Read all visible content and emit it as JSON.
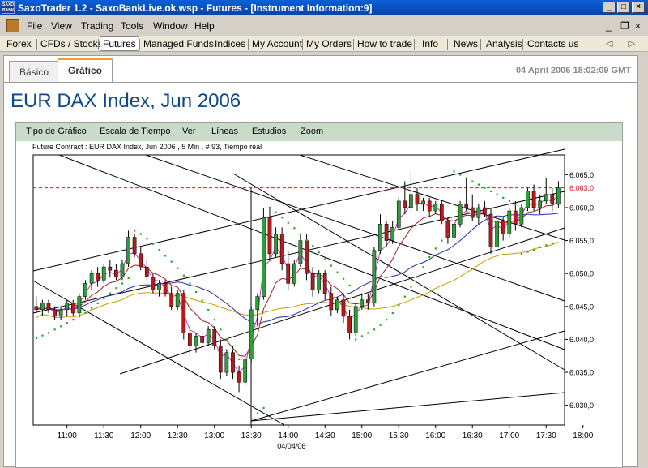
{
  "window": {
    "title": "SaxoTrader 1.2 - SaxoBankLive.ok.wsp - Futures - [Instrument Information:9]",
    "logo_text": "SAXO BANK",
    "controls": [
      "_",
      "□",
      "×"
    ]
  },
  "menu": {
    "items": [
      "File",
      "View",
      "Trading",
      "Tools",
      "Window",
      "Help"
    ],
    "mdi_controls": [
      "_",
      "❐",
      "×"
    ]
  },
  "nav": {
    "items": [
      "Forex",
      "CFDs / Stocks",
      "Futures",
      "Managed Funds",
      "Indices",
      "My Account",
      "My Orders",
      "How to trade",
      "Info",
      "News",
      "Analysis",
      "Contacts us"
    ],
    "active": "Futures",
    "arrows": "◁ ▷"
  },
  "tabs": {
    "items": [
      "Básico",
      "Gráfico"
    ],
    "active": "Gráfico"
  },
  "timestamp": "04 April 2006 18:02:09 GMT",
  "instrument_title": "EUR DAX Index, Jun 2006",
  "chart_toolbar": [
    "Tipo de Gráfico",
    "Escala de Tiempo",
    "Ver",
    "Líneas",
    "Estudios",
    "Zoom"
  ],
  "contract_info": "Future Contract : EUR DAX Index, Jun 2006 , 5 Min , # 93, Tiempo real",
  "colors": {
    "up_candle": "#2e9e3a",
    "down_candle": "#b81a1a",
    "ma_fast": "#cc33cc",
    "ma_mid": "#a02020",
    "ma_slow": "#2a2ab0",
    "ma_long": "#c8a000",
    "sar": "#22aa22",
    "last_price": "#d02020"
  },
  "chart_data": {
    "type": "candlestick",
    "xlabel": "04/04/06",
    "x_ticks": [
      "11:00",
      "11:30",
      "12:00",
      "12:30",
      "13:00",
      "13:30",
      "14:00",
      "14:30",
      "15:00",
      "15:30",
      "16:00",
      "16:30",
      "17:00",
      "17:30",
      "18:00"
    ],
    "y_ticks": [
      "6.065,0",
      "6.060,0",
      "6.055,0",
      "6.050,0",
      "6.045,0",
      "6.040,0",
      "6.035,0",
      "6.030,0"
    ],
    "ylim": [
      6027,
      6068
    ],
    "last_price": 6063.0,
    "last_price_label": "6.063,0",
    "interval_minutes": 5,
    "start_time": "10:35",
    "candles": [
      {
        "o": 6045.0,
        "h": 6046.5,
        "l": 6044.0,
        "c": 6044.5
      },
      {
        "o": 6044.5,
        "h": 6046.0,
        "l": 6043.5,
        "c": 6045.5
      },
      {
        "o": 6045.5,
        "h": 6046.0,
        "l": 6044.0,
        "c": 6044.5
      },
      {
        "o": 6044.5,
        "h": 6045.0,
        "l": 6043.0,
        "c": 6043.5
      },
      {
        "o": 6043.5,
        "h": 6045.0,
        "l": 6043.0,
        "c": 6044.5
      },
      {
        "o": 6044.5,
        "h": 6046.0,
        "l": 6043.5,
        "c": 6045.5
      },
      {
        "o": 6045.5,
        "h": 6046.0,
        "l": 6043.5,
        "c": 6044.0
      },
      {
        "o": 6044.0,
        "h": 6047.0,
        "l": 6043.5,
        "c": 6046.5
      },
      {
        "o": 6046.5,
        "h": 6049.0,
        "l": 6046.0,
        "c": 6048.5
      },
      {
        "o": 6048.5,
        "h": 6050.5,
        "l": 6047.5,
        "c": 6050.0
      },
      {
        "o": 6050.0,
        "h": 6051.0,
        "l": 6048.0,
        "c": 6049.0
      },
      {
        "o": 6049.0,
        "h": 6051.5,
        "l": 6048.5,
        "c": 6051.0
      },
      {
        "o": 6051.0,
        "h": 6052.0,
        "l": 6049.5,
        "c": 6050.5
      },
      {
        "o": 6050.5,
        "h": 6051.5,
        "l": 6049.0,
        "c": 6049.5
      },
      {
        "o": 6049.5,
        "h": 6052.0,
        "l": 6049.0,
        "c": 6051.5
      },
      {
        "o": 6051.5,
        "h": 6056.5,
        "l": 6051.0,
        "c": 6055.5
      },
      {
        "o": 6055.5,
        "h": 6056.0,
        "l": 6052.5,
        "c": 6053.0
      },
      {
        "o": 6053.0,
        "h": 6054.0,
        "l": 6050.5,
        "c": 6051.0
      },
      {
        "o": 6051.0,
        "h": 6052.0,
        "l": 6049.0,
        "c": 6049.5
      },
      {
        "o": 6049.5,
        "h": 6050.0,
        "l": 6047.0,
        "c": 6047.5
      },
      {
        "o": 6047.5,
        "h": 6049.0,
        "l": 6046.5,
        "c": 6048.5
      },
      {
        "o": 6048.5,
        "h": 6049.0,
        "l": 6046.5,
        "c": 6047.0
      },
      {
        "o": 6047.0,
        "h": 6048.0,
        "l": 6044.5,
        "c": 6045.0
      },
      {
        "o": 6045.0,
        "h": 6047.5,
        "l": 6044.5,
        "c": 6047.0
      },
      {
        "o": 6047.0,
        "h": 6047.5,
        "l": 6040.0,
        "c": 6041.0
      },
      {
        "o": 6041.0,
        "h": 6042.0,
        "l": 6037.5,
        "c": 6039.0
      },
      {
        "o": 6039.0,
        "h": 6041.0,
        "l": 6038.0,
        "c": 6040.5
      },
      {
        "o": 6040.5,
        "h": 6042.0,
        "l": 6038.5,
        "c": 6039.5
      },
      {
        "o": 6039.5,
        "h": 6042.0,
        "l": 6039.0,
        "c": 6041.5
      },
      {
        "o": 6041.5,
        "h": 6042.0,
        "l": 6038.5,
        "c": 6039.0
      },
      {
        "o": 6039.0,
        "h": 6040.0,
        "l": 6034.0,
        "c": 6035.0
      },
      {
        "o": 6035.0,
        "h": 6038.5,
        "l": 6034.5,
        "c": 6038.0
      },
      {
        "o": 6038.0,
        "h": 6039.0,
        "l": 6034.0,
        "c": 6035.0
      },
      {
        "o": 6035.0,
        "h": 6036.0,
        "l": 6032.0,
        "c": 6033.5
      },
      {
        "o": 6033.5,
        "h": 6037.5,
        "l": 6033.0,
        "c": 6037.0
      },
      {
        "o": 6037.0,
        "h": 6045.0,
        "l": 6036.5,
        "c": 6044.5
      },
      {
        "o": 6044.5,
        "h": 6047.0,
        "l": 6042.0,
        "c": 6046.5
      },
      {
        "o": 6046.5,
        "h": 6060.0,
        "l": 6046.0,
        "c": 6058.5
      },
      {
        "o": 6058.5,
        "h": 6060.0,
        "l": 6052.0,
        "c": 6053.0
      },
      {
        "o": 6053.0,
        "h": 6057.0,
        "l": 6052.5,
        "c": 6056.0
      },
      {
        "o": 6056.0,
        "h": 6057.0,
        "l": 6050.5,
        "c": 6051.5
      },
      {
        "o": 6051.5,
        "h": 6053.5,
        "l": 6047.5,
        "c": 6048.5
      },
      {
        "o": 6048.5,
        "h": 6052.0,
        "l": 6048.0,
        "c": 6051.5
      },
      {
        "o": 6051.5,
        "h": 6056.0,
        "l": 6051.0,
        "c": 6055.0
      },
      {
        "o": 6055.0,
        "h": 6056.0,
        "l": 6049.0,
        "c": 6050.0
      },
      {
        "o": 6050.0,
        "h": 6051.0,
        "l": 6046.5,
        "c": 6047.5
      },
      {
        "o": 6047.5,
        "h": 6050.5,
        "l": 6047.0,
        "c": 6050.0
      },
      {
        "o": 6050.0,
        "h": 6050.5,
        "l": 6046.0,
        "c": 6047.0
      },
      {
        "o": 6047.0,
        "h": 6048.0,
        "l": 6043.5,
        "c": 6044.5
      },
      {
        "o": 6044.5,
        "h": 6046.5,
        "l": 6044.0,
        "c": 6046.0
      },
      {
        "o": 6046.0,
        "h": 6047.0,
        "l": 6042.5,
        "c": 6043.5
      },
      {
        "o": 6043.5,
        "h": 6044.5,
        "l": 6040.0,
        "c": 6041.0
      },
      {
        "o": 6041.0,
        "h": 6045.5,
        "l": 6040.5,
        "c": 6045.0
      },
      {
        "o": 6045.0,
        "h": 6047.0,
        "l": 6044.5,
        "c": 6046.0
      },
      {
        "o": 6046.0,
        "h": 6047.0,
        "l": 6044.5,
        "c": 6045.5
      },
      {
        "o": 6045.5,
        "h": 6054.0,
        "l": 6045.0,
        "c": 6053.5
      },
      {
        "o": 6053.5,
        "h": 6059.0,
        "l": 6053.0,
        "c": 6057.5
      },
      {
        "o": 6057.5,
        "h": 6058.0,
        "l": 6054.0,
        "c": 6055.0
      },
      {
        "o": 6055.0,
        "h": 6058.0,
        "l": 6054.5,
        "c": 6057.0
      },
      {
        "o": 6057.0,
        "h": 6061.5,
        "l": 6056.5,
        "c": 6061.0
      },
      {
        "o": 6061.0,
        "h": 6064.0,
        "l": 6059.0,
        "c": 6060.0
      },
      {
        "o": 6060.0,
        "h": 6065.5,
        "l": 6059.5,
        "c": 6062.0
      },
      {
        "o": 6062.0,
        "h": 6063.0,
        "l": 6059.5,
        "c": 6060.5
      },
      {
        "o": 6060.5,
        "h": 6061.5,
        "l": 6059.5,
        "c": 6061.0
      },
      {
        "o": 6061.0,
        "h": 6061.5,
        "l": 6058.5,
        "c": 6059.5
      },
      {
        "o": 6059.5,
        "h": 6061.0,
        "l": 6059.0,
        "c": 6060.5
      },
      {
        "o": 6060.5,
        "h": 6061.0,
        "l": 6057.5,
        "c": 6058.0
      },
      {
        "o": 6058.0,
        "h": 6058.5,
        "l": 6054.5,
        "c": 6055.5
      },
      {
        "o": 6055.5,
        "h": 6058.0,
        "l": 6055.0,
        "c": 6057.5
      },
      {
        "o": 6057.5,
        "h": 6061.0,
        "l": 6057.0,
        "c": 6060.5
      },
      {
        "o": 6060.5,
        "h": 6064.5,
        "l": 6059.5,
        "c": 6060.0
      },
      {
        "o": 6060.0,
        "h": 6062.0,
        "l": 6058.0,
        "c": 6058.5
      },
      {
        "o": 6058.5,
        "h": 6060.5,
        "l": 6057.5,
        "c": 6060.0
      },
      {
        "o": 6060.0,
        "h": 6061.0,
        "l": 6058.5,
        "c": 6059.0
      },
      {
        "o": 6059.0,
        "h": 6060.0,
        "l": 6053.0,
        "c": 6054.0
      },
      {
        "o": 6054.0,
        "h": 6058.5,
        "l": 6053.5,
        "c": 6058.0
      },
      {
        "o": 6058.0,
        "h": 6058.5,
        "l": 6055.0,
        "c": 6056.0
      },
      {
        "o": 6056.0,
        "h": 6060.0,
        "l": 6055.5,
        "c": 6059.5
      },
      {
        "o": 6059.5,
        "h": 6061.0,
        "l": 6056.5,
        "c": 6057.5
      },
      {
        "o": 6057.5,
        "h": 6060.5,
        "l": 6057.0,
        "c": 6060.0
      },
      {
        "o": 6060.0,
        "h": 6063.0,
        "l": 6059.5,
        "c": 6062.5
      },
      {
        "o": 6062.5,
        "h": 6063.5,
        "l": 6059.5,
        "c": 6060.0
      },
      {
        "o": 6060.0,
        "h": 6062.0,
        "l": 6059.0,
        "c": 6061.0
      },
      {
        "o": 6061.0,
        "h": 6064.5,
        "l": 6060.5,
        "c": 6062.0
      },
      {
        "o": 6062.0,
        "h": 6063.0,
        "l": 6059.5,
        "c": 6060.5
      },
      {
        "o": 6060.5,
        "h": 6064.0,
        "l": 6060.0,
        "c": 6063.0
      }
    ],
    "sar": [
      6040.2,
      6040.6,
      6041.0,
      6041.5,
      6042.0,
      6042.5,
      6043.0,
      6043.5,
      6044.0,
      6044.8,
      6045.5,
      6046.2,
      6047.0,
      6047.8,
      6048.5,
      6049.3,
      6056.5,
      6056.0,
      6055.3,
      6054.5,
      6053.6,
      6052.7,
      6051.8,
      6050.8,
      6049.7,
      6048.5,
      6047.2,
      6045.9,
      6044.5,
      6043.0,
      6041.5,
      6040.0,
      6038.5,
      6037.0,
      6035.5,
      6028.0,
      6028.8,
      6029.6,
      6060.0,
      6059.3,
      6058.5,
      6057.7,
      6056.9,
      6056.0,
      6055.1,
      6054.2,
      6053.2,
      6052.2,
      6051.2,
      6050.2,
      6049.2,
      6048.2,
      6040.0,
      6040.5,
      6041.0,
      6041.5,
      6042.2,
      6043.0,
      6044.0,
      6045.2,
      6046.5,
      6048.0,
      6049.5,
      6051.0,
      6052.5,
      6053.8,
      6055.0,
      6056.0,
      6065.5,
      6065.0,
      6064.5,
      6064.0,
      6063.5,
      6063.0,
      6062.5,
      6062.0,
      6061.5,
      6061.0,
      6060.5,
      6053.0,
      6053.3,
      6053.6,
      6054.0,
      6054.3,
      6054.6
    ]
  }
}
